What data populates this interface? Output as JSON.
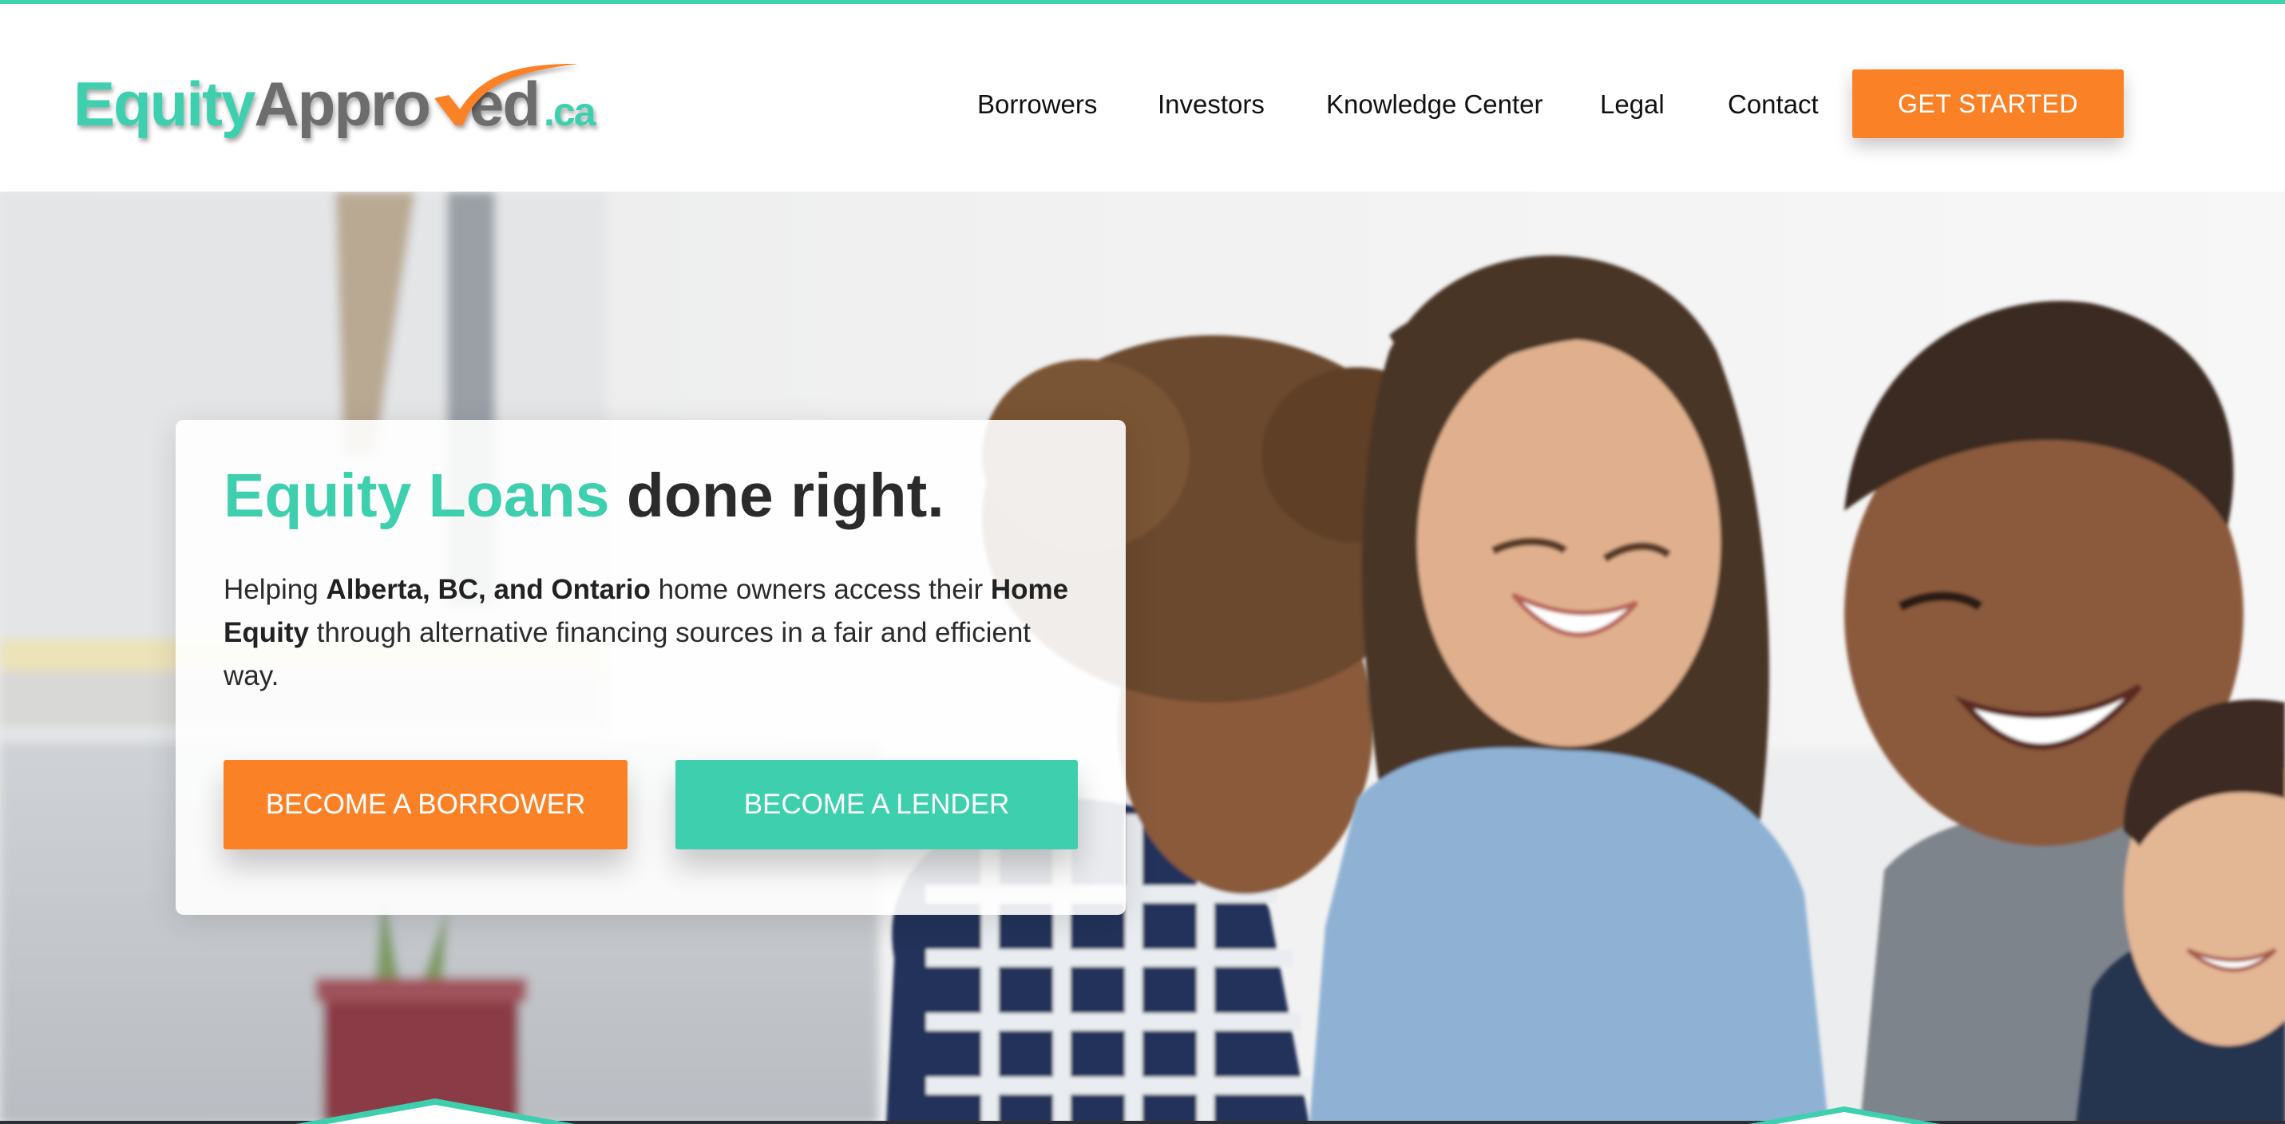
{
  "header": {
    "logo": {
      "part1": "Equity",
      "part2": "Appro",
      "part3": "ed",
      "suffix": ".ca",
      "alt": "EquityApproved.ca"
    },
    "nav": [
      {
        "label": "Borrowers"
      },
      {
        "label": "Investors"
      },
      {
        "label": "Knowledge Center"
      },
      {
        "label": "Legal"
      },
      {
        "label": "Contact"
      }
    ],
    "cta_label": "GET STARTED"
  },
  "hero": {
    "title_accent": "Equity Loans",
    "title_rest": " done right.",
    "body": {
      "t1": "Helping ",
      "b1": "Alberta, BC, and Ontario",
      "t2": " home owners access their ",
      "b2": "Home Equity",
      "t3": " through alternative financing sources in a fair and efficient way."
    },
    "borrower_button": "BECOME A BORROWER",
    "lender_button": "BECOME A LENDER"
  },
  "colors": {
    "brand_teal": "#3ecfae",
    "brand_orange": "#fb8127",
    "logo_gray": "#6d6d6d",
    "text_dark": "#2b2b2b"
  },
  "icons": [
    "checkmark-logo-icon"
  ]
}
